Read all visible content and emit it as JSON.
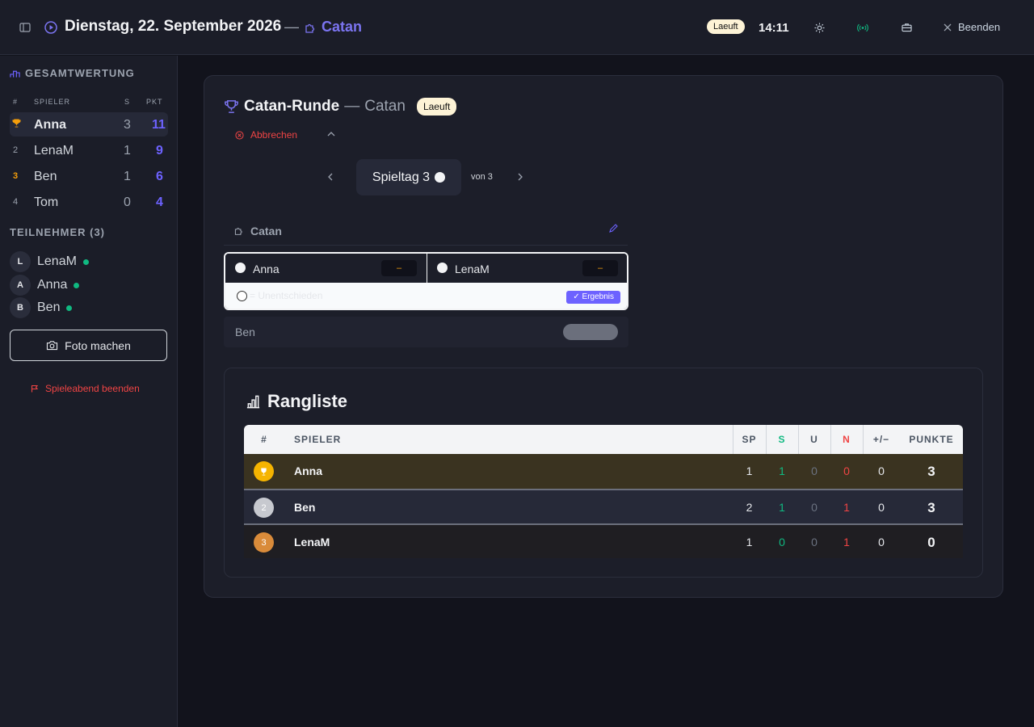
{
  "header": {
    "date": "Dienstag, 22. September 2026",
    "separator": "—",
    "game": "Catan",
    "status": "Laeuft",
    "time": "14:11",
    "quit_label": "Beenden"
  },
  "sidebar": {
    "standings_title": "GESAMTWERTUNG",
    "columns": {
      "rank": "#",
      "player": "SPIELER",
      "wins": "S",
      "points": "PKT"
    },
    "standings": [
      {
        "rank": "",
        "name": "Anna",
        "wins": "3",
        "points": "11"
      },
      {
        "rank": "2",
        "name": "LenaM",
        "wins": "1",
        "points": "9"
      },
      {
        "rank": "3",
        "name": "Ben",
        "wins": "1",
        "points": "6"
      },
      {
        "rank": "4",
        "name": "Tom",
        "wins": "0",
        "points": "4"
      }
    ],
    "participants_title": "TEILNEHMER (3)",
    "participants": [
      {
        "initial": "L",
        "name": "LenaM"
      },
      {
        "initial": "A",
        "name": "Anna"
      },
      {
        "initial": "B",
        "name": "Ben"
      }
    ],
    "photo_button": "Foto machen",
    "end_evening": "Spieleabend beenden"
  },
  "round": {
    "title": "Catan-Runde",
    "dash": "—",
    "game": "Catan",
    "status": "Laeuft",
    "abort_label": "Abbrechen",
    "day_label": "Spieltag 3",
    "of_label": "von 3",
    "game_section": "Catan",
    "match": {
      "player1": "Anna",
      "player2": "LenaM",
      "score1": "–",
      "score2": "–",
      "draw_label": "= Unentschieden",
      "result_button": "✓ Ergebnis"
    },
    "bye_player": "Ben"
  },
  "ranking": {
    "title": "Rangliste",
    "columns": {
      "rank": "#",
      "player": "SPIELER",
      "played": "SP",
      "wins": "S",
      "draws": "U",
      "losses": "N",
      "diff": "+/−",
      "points": "PUNKTE"
    },
    "rows": [
      {
        "rank": "1",
        "name": "Anna",
        "played": "1",
        "wins": "1",
        "draws": "0",
        "losses": "0",
        "diff": "0",
        "points": "3"
      },
      {
        "rank": "2",
        "name": "Ben",
        "played": "2",
        "wins": "1",
        "draws": "0",
        "losses": "1",
        "diff": "0",
        "points": "3"
      },
      {
        "rank": "3",
        "name": "LenaM",
        "played": "1",
        "wins": "0",
        "draws": "0",
        "losses": "1",
        "diff": "0",
        "points": "0"
      }
    ]
  },
  "colors": {
    "accent": "#6d62ff",
    "danger": "#ef4444",
    "success": "#10b981",
    "gold": "#f5b400",
    "silver": "#c7c9cf",
    "bronze": "#d98b3a"
  }
}
